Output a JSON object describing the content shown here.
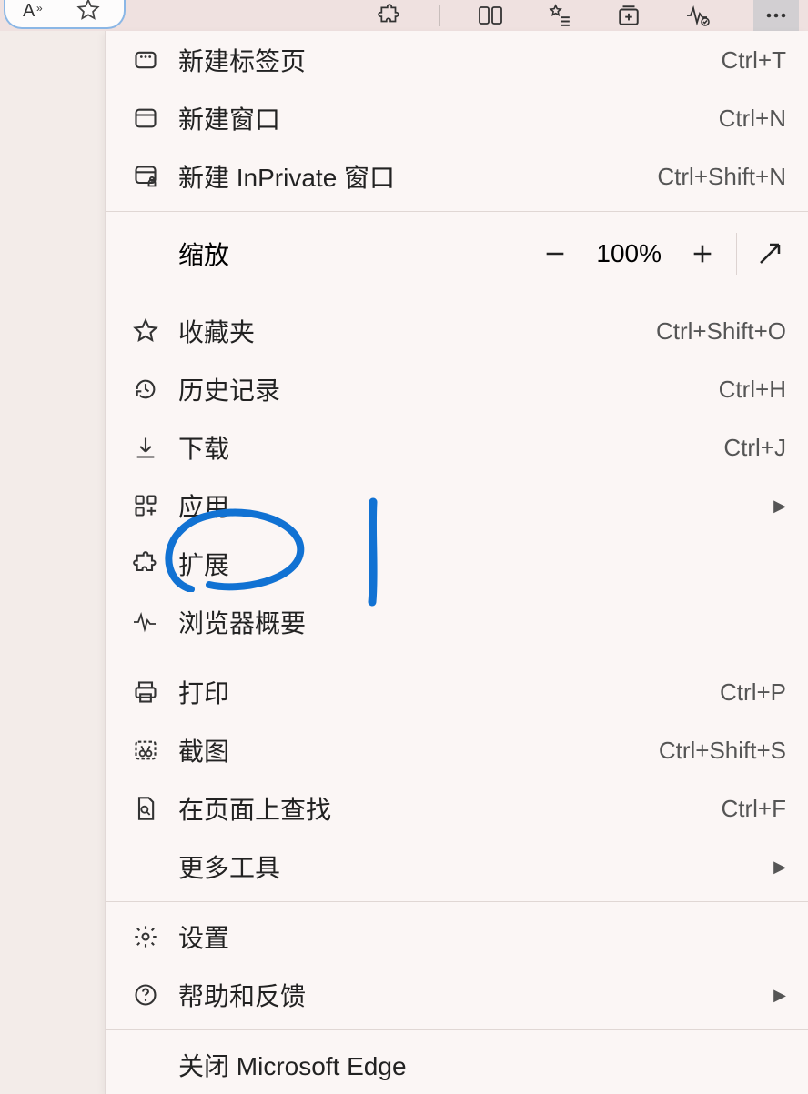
{
  "toolbar": {
    "icons": [
      "text-size-icon",
      "favorite-star-icon",
      "extensions-icon",
      "split-screen-icon",
      "favorites-list-icon",
      "collections-icon",
      "performance-icon",
      "more-icon"
    ]
  },
  "menu": {
    "new_tab": {
      "label": "新建标签页",
      "shortcut": "Ctrl+T"
    },
    "new_window": {
      "label": "新建窗口",
      "shortcut": "Ctrl+N"
    },
    "new_inprivate": {
      "label": "新建 InPrivate 窗口",
      "shortcut": "Ctrl+Shift+N"
    },
    "zoom": {
      "label": "缩放",
      "value": "100%"
    },
    "favorites": {
      "label": "收藏夹",
      "shortcut": "Ctrl+Shift+O"
    },
    "history": {
      "label": "历史记录",
      "shortcut": "Ctrl+H"
    },
    "downloads": {
      "label": "下载",
      "shortcut": "Ctrl+J"
    },
    "apps": {
      "label": "应用"
    },
    "extensions": {
      "label": "扩展"
    },
    "browser_essentials": {
      "label": "浏览器概要"
    },
    "print": {
      "label": "打印",
      "shortcut": "Ctrl+P"
    },
    "screenshot": {
      "label": "截图",
      "shortcut": "Ctrl+Shift+S"
    },
    "find": {
      "label": "在页面上查找",
      "shortcut": "Ctrl+F"
    },
    "more_tools": {
      "label": "更多工具"
    },
    "settings": {
      "label": "设置"
    },
    "help": {
      "label": "帮助和反馈"
    },
    "close": {
      "label": "关闭 Microsoft Edge"
    }
  }
}
